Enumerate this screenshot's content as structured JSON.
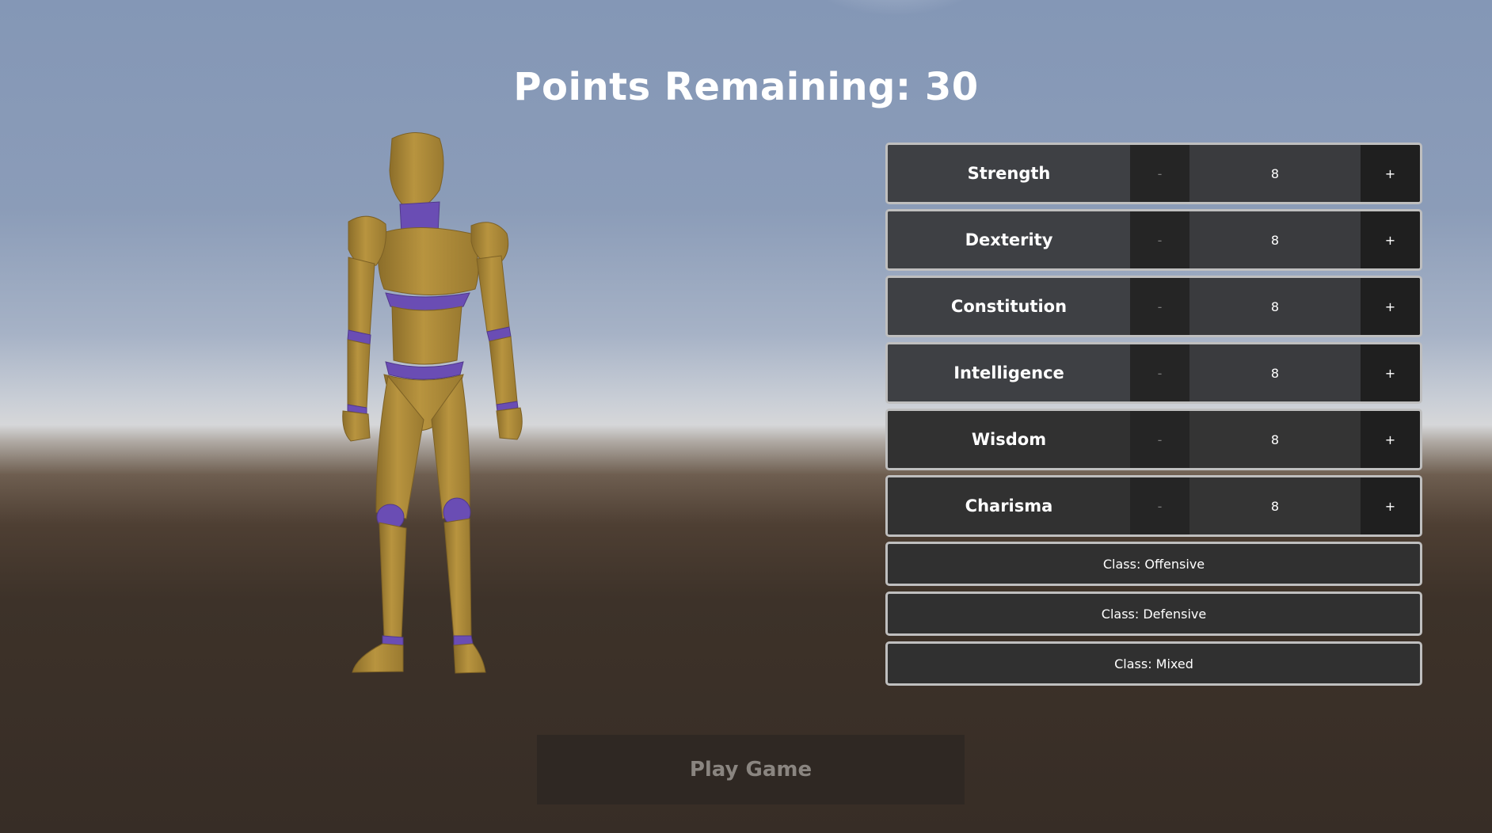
{
  "header": {
    "points_label": "Points Remaining: 30"
  },
  "stats": [
    {
      "label": "Strength",
      "minus": "-",
      "value": "8",
      "plus": "+"
    },
    {
      "label": "Dexterity",
      "minus": "-",
      "value": "8",
      "plus": "+"
    },
    {
      "label": "Constitution",
      "minus": "-",
      "value": "8",
      "plus": "+"
    },
    {
      "label": "Intelligence",
      "minus": "-",
      "value": "8",
      "plus": "+"
    },
    {
      "label": "Wisdom",
      "minus": "-",
      "value": "8",
      "plus": "+"
    },
    {
      "label": "Charisma",
      "minus": "-",
      "value": "8",
      "plus": "+"
    }
  ],
  "classes": [
    {
      "label": "Class: Offensive"
    },
    {
      "label": "Class: Defensive"
    },
    {
      "label": "Class: Mixed"
    }
  ],
  "play_button": {
    "label": "Play Game"
  },
  "colors": {
    "mannequin_body": "#b08d3c",
    "mannequin_joint": "#6a4db4",
    "panel_border": "#bfbfbf",
    "panel_bg": "#2f2f2f"
  }
}
